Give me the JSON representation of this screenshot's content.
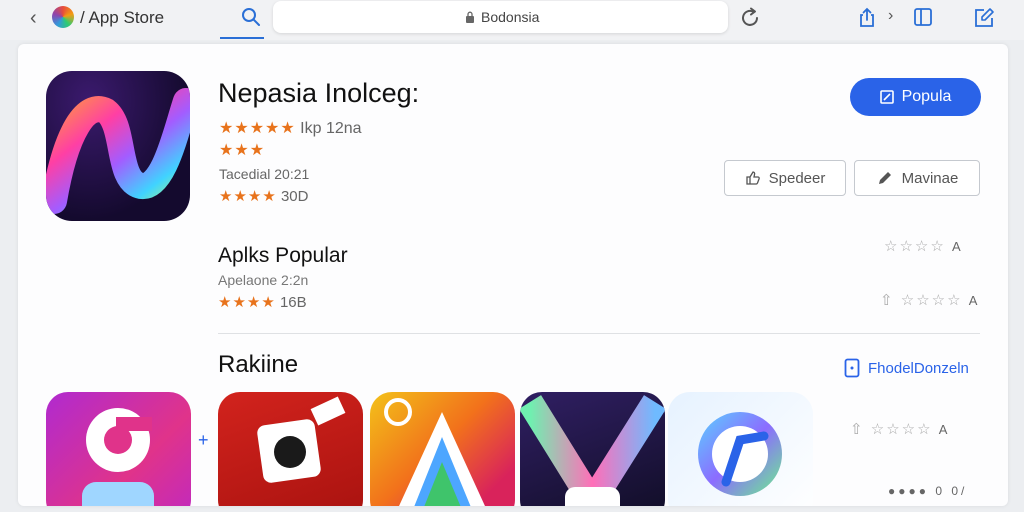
{
  "browser": {
    "site_title": "/ App Store",
    "url": "Bodonsia"
  },
  "app": {
    "title": "Nepasia Inolceg:",
    "rating_label": "Ikp",
    "rating_value": "12na",
    "developer": "Tacedial 20:21",
    "rating_count": "30D",
    "get_button": "Popula",
    "secondary_buttons": [
      "Spedeer",
      "Mavinae"
    ]
  },
  "section2": {
    "title": "Aplks Popular",
    "developer": "Apelaone 2:2n",
    "size": "16B",
    "right_rating_1": "A",
    "right_rating_2": "A"
  },
  "section3": {
    "title": "Rakiine",
    "link": "FhodelDonzeln",
    "right_rating": "A",
    "pager_text": "0 0/"
  },
  "colors": {
    "accent": "#2a63e8",
    "star": "#e8731c",
    "panel": "#fdfdfe"
  }
}
